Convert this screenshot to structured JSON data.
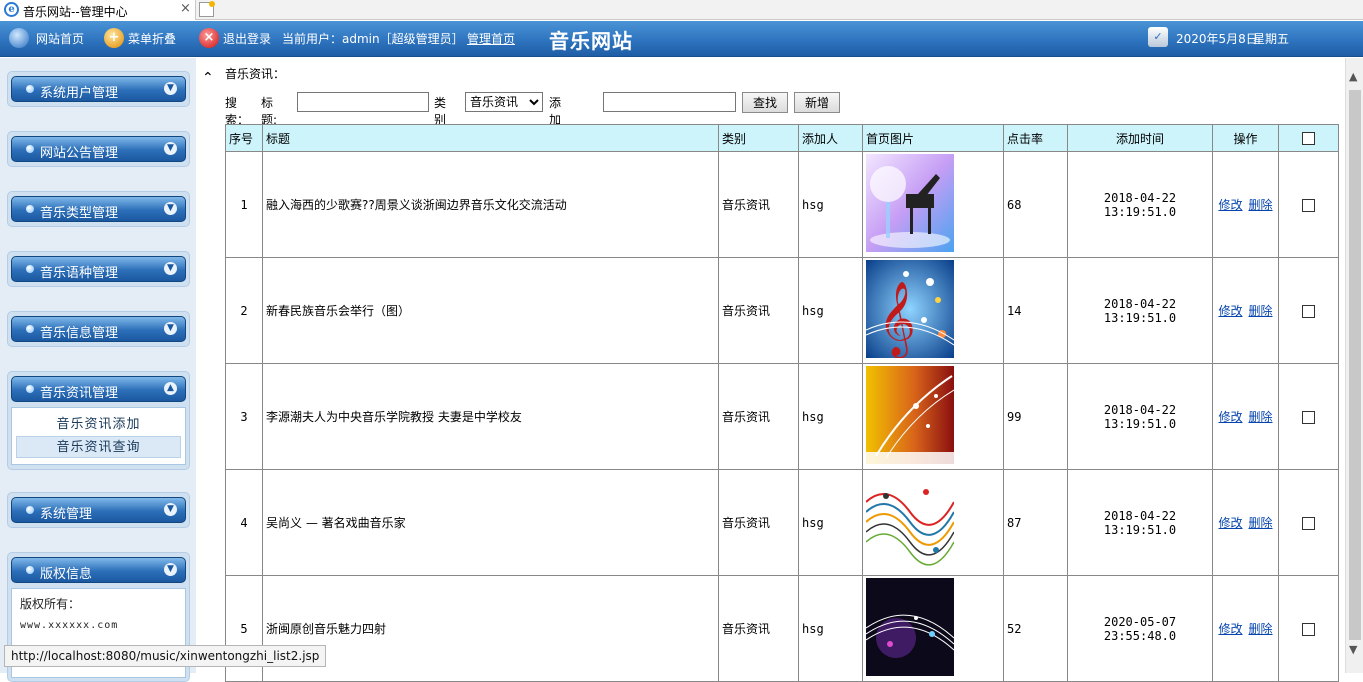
{
  "browser": {
    "tab_title": "音乐网站--管理中心",
    "close_glyph": "×",
    "status_url": "http://localhost:8080/music/xinwentongzhi_list2.jsp"
  },
  "topbar": {
    "home_link": "网站首页",
    "menu_toggle": "菜单折叠",
    "logout": "退出登录",
    "current_user": "当前用户：admin［超级管理员］",
    "admin_home": "管理首页",
    "site_name": "音乐网站",
    "date": "2020年5月8日",
    "weekday": "星期五"
  },
  "sidebar": {
    "menus": [
      {
        "label": "系统用户管理"
      },
      {
        "label": "网站公告管理"
      },
      {
        "label": "音乐类型管理"
      },
      {
        "label": "音乐语种管理"
      },
      {
        "label": "音乐信息管理"
      },
      {
        "label": "音乐资讯管理",
        "expanded": true,
        "items": [
          "音乐资讯添加",
          "音乐资讯查询"
        ]
      },
      {
        "label": "系统管理"
      },
      {
        "label": "版权信息",
        "expanded": true
      }
    ],
    "copyright": {
      "owner_label": "版权所有：",
      "site": "www.xxxxxx.com"
    }
  },
  "main": {
    "section_title": "音乐资讯：",
    "search": {
      "label": "搜索：",
      "title_label": "标题:",
      "category_label": "类别",
      "category_value": "音乐资讯",
      "adder_label": "添加人:",
      "find_button": "查找",
      "add_button": "新增"
    },
    "table": {
      "columns": [
        "序号",
        "标题",
        "类别",
        "添加人",
        "首页图片",
        "点击率",
        "添加时间",
        "操作"
      ],
      "rows": [
        {
          "no": "1",
          "title": "融入海西的少歌赛??周景义谈浙闽边界音乐文化交流活动",
          "category": "音乐资讯",
          "adder": "hsg",
          "clicks": "68",
          "time": "2018-04-22 13:19:51.0",
          "edit": "修改",
          "delete": "删除",
          "image": "piano-image"
        },
        {
          "no": "2",
          "title": "新春民族音乐会举行（图）",
          "category": "音乐资讯",
          "adder": "hsg",
          "clicks": "14",
          "time": "2018-04-22 13:19:51.0",
          "edit": "修改",
          "delete": "删除",
          "image": "treble-clef-image"
        },
        {
          "no": "3",
          "title": "李源潮夫人为中央音乐学院教授 夫妻是中学校友",
          "category": "音乐资讯",
          "adder": "hsg",
          "clicks": "99",
          "time": "2018-04-22 13:19:51.0",
          "edit": "修改",
          "delete": "删除",
          "image": "gold-notes-image"
        },
        {
          "no": "4",
          "title": "吴尚义 — 著名戏曲音乐家",
          "category": "音乐资讯",
          "adder": "hsg",
          "clicks": "87",
          "time": "2018-04-22 13:19:51.0",
          "edit": "修改",
          "delete": "删除",
          "image": "staff-waves-image"
        },
        {
          "no": "5",
          "title": "浙闽原创音乐魅力四射",
          "category": "音乐资讯",
          "adder": "hsg",
          "clicks": "52",
          "time": "2020-05-07 23:55:48.0",
          "edit": "修改",
          "delete": "删除",
          "image": "dark-notes-image"
        }
      ]
    }
  }
}
